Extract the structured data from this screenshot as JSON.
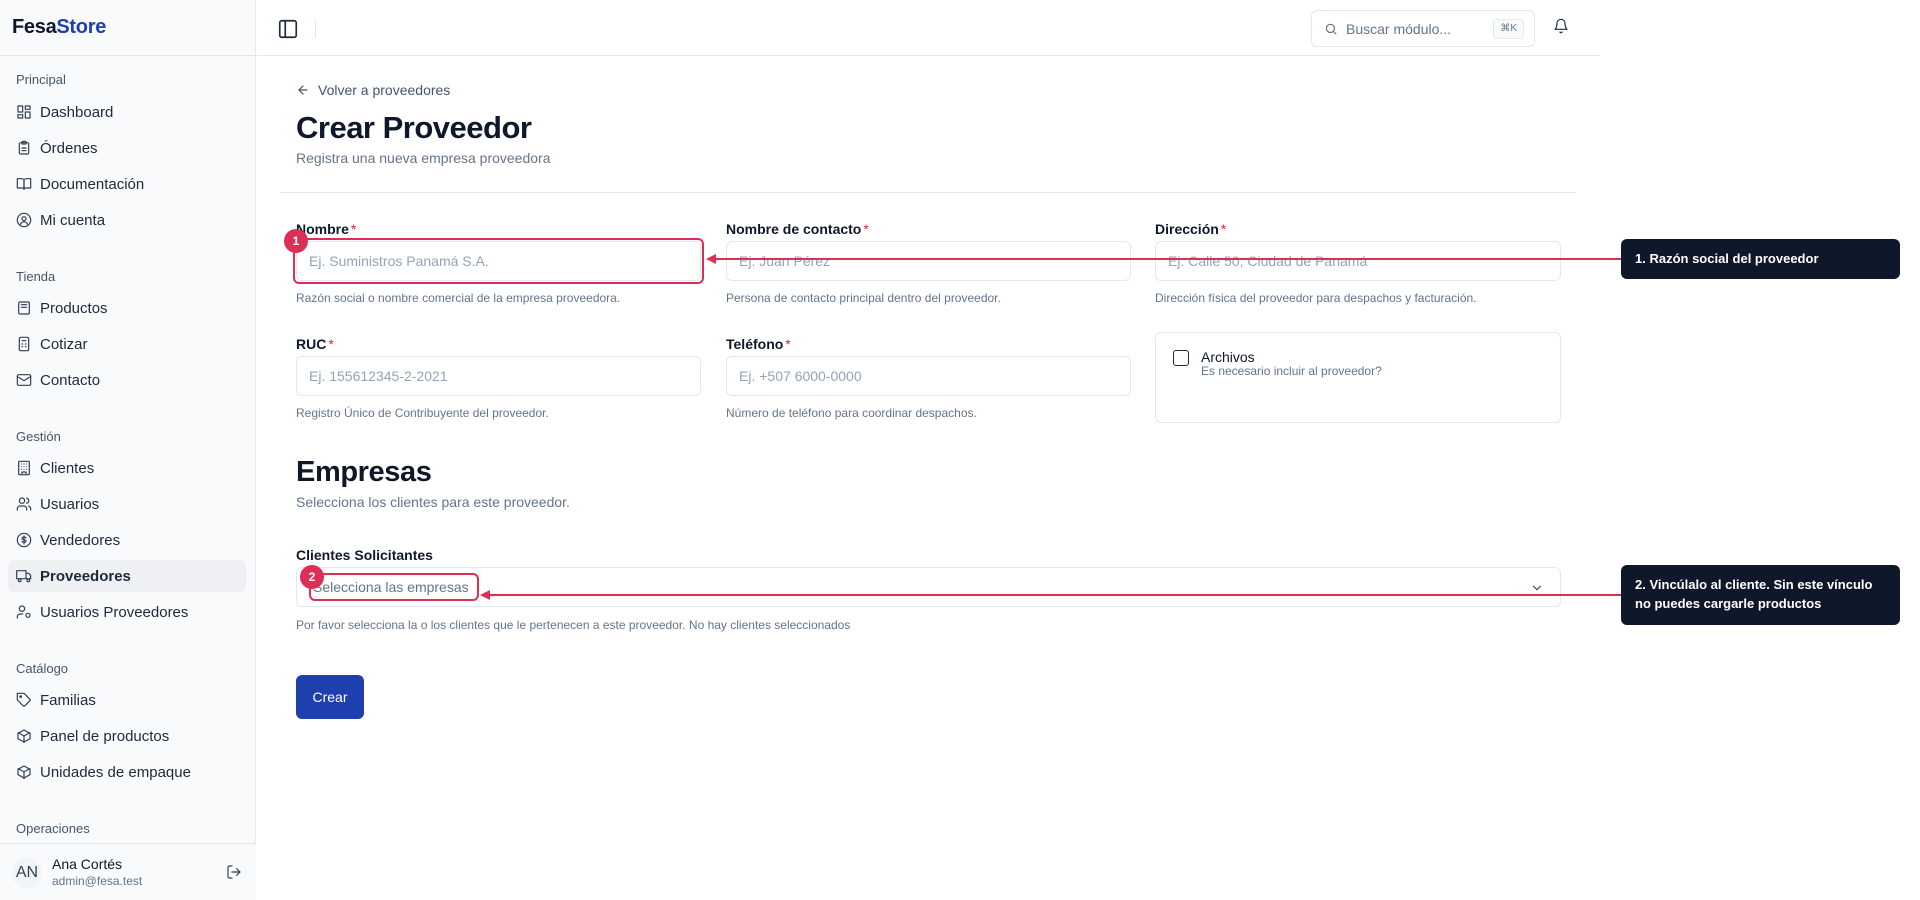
{
  "app": {
    "brand_prefix": "Fesa",
    "brand_suffix": "Store"
  },
  "sidebar": {
    "sections": [
      {
        "label": "Principal",
        "items": [
          {
            "label": "Dashboard",
            "icon": "dashboard-icon"
          },
          {
            "label": "Órdenes",
            "icon": "clipboard-icon"
          },
          {
            "label": "Documentación",
            "icon": "book-icon"
          },
          {
            "label": "Mi cuenta",
            "icon": "user-circle-icon"
          }
        ]
      },
      {
        "label": "Tienda",
        "items": [
          {
            "label": "Productos",
            "icon": "package-icon"
          },
          {
            "label": "Cotizar",
            "icon": "calculator-icon"
          },
          {
            "label": "Contacto",
            "icon": "mail-icon"
          }
        ]
      },
      {
        "label": "Gestión",
        "items": [
          {
            "label": "Clientes",
            "icon": "building-icon"
          },
          {
            "label": "Usuarios",
            "icon": "users-icon"
          },
          {
            "label": "Vendedores",
            "icon": "dollar-circle-icon"
          },
          {
            "label": "Proveedores",
            "icon": "truck-icon",
            "active": true
          },
          {
            "label": "Usuarios Proveedores",
            "icon": "user-cog-icon"
          }
        ]
      },
      {
        "label": "Catálogo",
        "items": [
          {
            "label": "Familias",
            "icon": "tag-icon"
          },
          {
            "label": "Panel de productos",
            "icon": "box-icon"
          },
          {
            "label": "Unidades de empaque",
            "icon": "box-icon"
          }
        ]
      },
      {
        "label": "Operaciones",
        "items": []
      }
    ],
    "user": {
      "initials": "AN",
      "name": "Ana Cortés",
      "email": "admin@fesa.test"
    }
  },
  "topbar": {
    "search_placeholder": "Buscar módulo...",
    "search_shortcut": "⌘K"
  },
  "page": {
    "back_label": "Volver a proveedores",
    "title": "Crear Proveedor",
    "subtitle": "Registra una nueva empresa proveedora"
  },
  "form": {
    "required_mark": "*",
    "nombre": {
      "label": "Nombre",
      "placeholder": "Ej. Suministros Panamá S.A.",
      "help": "Razón social o nombre comercial de la empresa proveedora.",
      "value": ""
    },
    "contacto": {
      "label": "Nombre de contacto",
      "placeholder": "Ej. Juan Pérez",
      "help": "Persona de contacto principal dentro del proveedor.",
      "value": ""
    },
    "direccion": {
      "label": "Dirección",
      "placeholder": "Ej. Calle 50, Ciudad de Panamá",
      "help": "Dirección física del proveedor para despachos y facturación.",
      "value": ""
    },
    "ruc": {
      "label": "RUC",
      "placeholder": "Ej. 155612345-2-2021",
      "help": "Registro Único de Contribuyente del proveedor.",
      "value": ""
    },
    "telefono": {
      "label": "Teléfono",
      "placeholder": "Ej. +507 6000-0000",
      "help": "Número de teléfono para coordinar despachos.",
      "value": ""
    },
    "archivos": {
      "label": "Archivos",
      "description": "Es necesario incluir al proveedor?",
      "checked": false
    }
  },
  "empresas": {
    "title": "Empresas",
    "subtitle": "Selecciona los clientes para este proveedor.",
    "field_label": "Clientes Solicitantes",
    "placeholder": "Selecciona las empresas",
    "help": "Por favor selecciona la o los clientes que le pertenecen a este proveedor. No hay clientes seleccionados"
  },
  "submit_label": "Crear",
  "annotations": [
    {
      "number": "1",
      "text": "1. Razón social del proveedor"
    },
    {
      "number": "2",
      "text_line1": "2. Vincúlalo al cliente. Sin este vínculo",
      "text_line2": "no puedes cargarle productos"
    }
  ],
  "colors": {
    "brand": "#1e40af",
    "annotation": "#dc2f56",
    "tooltip_bg": "#0f172a",
    "required": "#dc2626"
  }
}
